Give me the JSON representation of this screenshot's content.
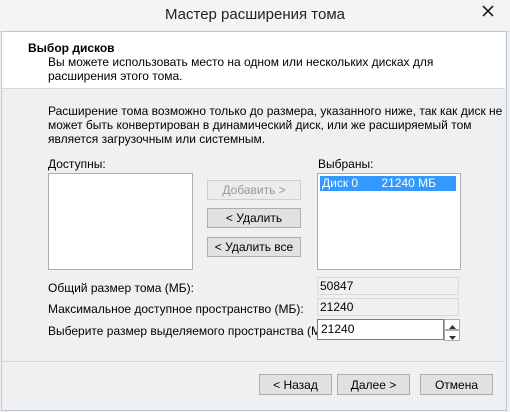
{
  "window": {
    "title": "Мастер расширения тома"
  },
  "header": {
    "title": "Выбор дисков",
    "subtitle": "Вы можете использовать место на одном или нескольких дисках для расширения этого тома."
  },
  "info_text": "Расширение тома возможно только до размера, указанного ниже, так как диск не может быть конвертирован в динамический диск, или же расширяемый том является загрузочным или системным.",
  "available": {
    "label": "Доступны:",
    "items": []
  },
  "selected": {
    "label": "Выбраны:",
    "items": [
      {
        "disk": "Диск 0",
        "size": "21240 МБ"
      }
    ]
  },
  "buttons": {
    "add": "Добавить >",
    "remove": "< Удалить",
    "remove_all": "< Удалить все"
  },
  "fields": {
    "total_label": "Общий размер тома (МБ):",
    "total_value": "50847",
    "max_label": "Максимальное доступное пространство (МБ):",
    "max_value": "21240",
    "select_label": "Выберите размер выделяемого пространства (МБ):",
    "select_value": "21240"
  },
  "footer": {
    "back": "< Назад",
    "next": "Далее >",
    "cancel": "Отмена"
  },
  "icons": {
    "close": "close-icon",
    "spin_up": "chevron-up-icon",
    "spin_down": "chevron-down-icon"
  },
  "colors": {
    "selection": "#3399ff",
    "frame_border": "#b7c7dc"
  }
}
